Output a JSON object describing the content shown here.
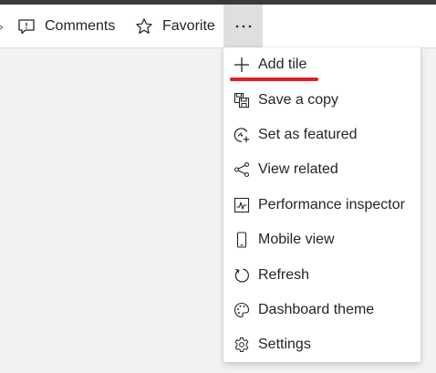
{
  "toolbar": {
    "comments_label": "Comments",
    "favorite_label": "Favorite",
    "more_glyph": "···"
  },
  "menu": {
    "items": [
      {
        "label": "Add tile",
        "icon": "plus-icon"
      },
      {
        "label": "Save a copy",
        "icon": "save-copy-icon"
      },
      {
        "label": "Set as featured",
        "icon": "featured-icon"
      },
      {
        "label": "View related",
        "icon": "related-icon"
      },
      {
        "label": "Performance inspector",
        "icon": "performance-icon"
      },
      {
        "label": "Mobile view",
        "icon": "mobile-icon"
      },
      {
        "label": "Refresh",
        "icon": "refresh-icon"
      },
      {
        "label": "Dashboard theme",
        "icon": "palette-icon"
      },
      {
        "label": "Settings",
        "icon": "gear-icon"
      }
    ]
  },
  "colors": {
    "text": "#252423",
    "toolbar_bg": "#ffffff",
    "canvas_bg": "#f3f2f1",
    "active_button_bg": "#e1dfdd",
    "annotation_red": "#e01e26"
  }
}
